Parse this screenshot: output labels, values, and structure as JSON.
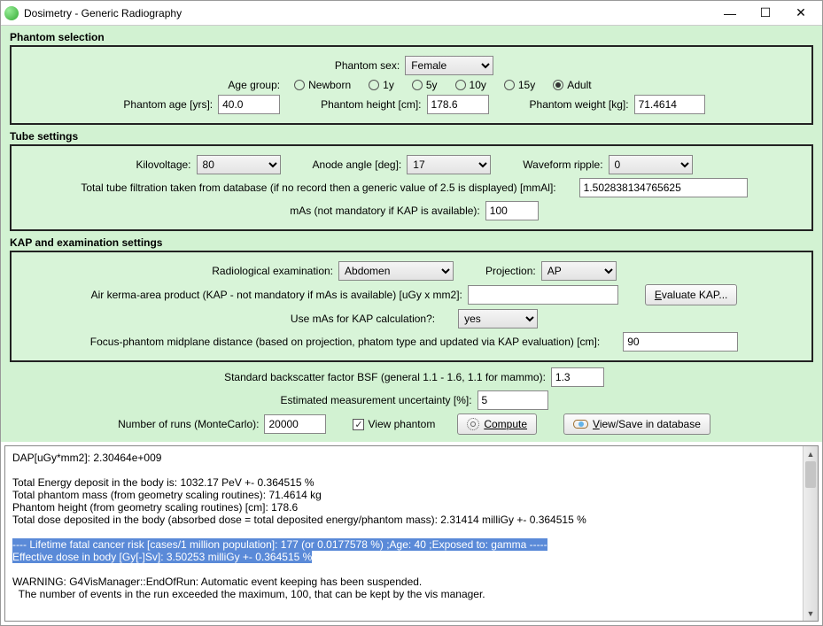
{
  "title": "Dosimetry - Generic Radiography",
  "phantom": {
    "section": "Phantom selection",
    "sex_label": "Phantom sex:",
    "sex_value": "Female",
    "age_group_label": "Age group:",
    "age_groups": [
      "Newborn",
      "1y",
      "5y",
      "10y",
      "15y",
      "Adult"
    ],
    "age_selected_index": 5,
    "age_label": "Phantom age [yrs]:",
    "age_value": "40.0",
    "height_label": "Phantom height [cm]:",
    "height_value": "178.6",
    "weight_label": "Phantom weight [kg]:",
    "weight_value": "71.4614"
  },
  "tube": {
    "section": "Tube settings",
    "kv_label": "Kilovoltage:",
    "kv_value": "80",
    "anode_label": "Anode angle [deg]:",
    "anode_value": "17",
    "ripple_label": "Waveform ripple:",
    "ripple_value": "0",
    "filt_label": "Total tube filtration taken from database (if no record then a generic value of 2.5 is displayed) [mmAl]:",
    "filt_value": "1.502838134765625",
    "mas_label": "mAs (not mandatory if KAP is available):",
    "mas_value": "100"
  },
  "kap": {
    "section": "KAP and examination settings",
    "exam_label": "Radiological examination:",
    "exam_value": "Abdomen",
    "proj_label": "Projection:",
    "proj_value": "AP",
    "kap_label": "Air kerma-area product (KAP - not mandatory if mAs is available) [uGy x mm2]:",
    "kap_value": "",
    "eval_btn": "Evaluate KAP...",
    "use_mas_label": "Use mAs for KAP calculation?:",
    "use_mas_value": "yes",
    "focus_label": "Focus-phantom midplane distance (based on projection, phatom type and updated via KAP evaluation) [cm]:",
    "focus_value": "90"
  },
  "extra": {
    "bsf_label": "Standard backscatter factor BSF (general 1.1 - 1.6, 1.1 for mammo):",
    "bsf_value": "1.3",
    "unc_label": "Estimated measurement uncertainty [%]:",
    "unc_value": "5",
    "runs_label": "Number of runs (MonteCarlo):",
    "runs_value": "20000",
    "view_phantom_label": "View phantom",
    "compute_label": "Compute",
    "viewsave_label": "View/Save in database"
  },
  "output": {
    "line1": "DAP[uGy*mm2]: 2.30464e+009",
    "line2": "Total Energy deposit in the body is: 1032.17 PeV +- 0.364515 %",
    "line3": "Total phantom mass (from geometry scaling routines): 71.4614 kg",
    "line4": "Phantom height (from geometry scaling routines) [cm]: 178.6",
    "line5": "Total dose deposited in the body (absorbed dose = total deposited energy/phantom mass): 2.31414 milliGy +- 0.364515 %",
    "hl1": "---- Lifetime fatal cancer risk [cases/1 million population]: 177 (or 0.0177578 %) ;Age: 40 ;Exposed to: gamma -----",
    "hl2": "Effective dose in body [Gy[-]Sv]: 3.50253 milliGy +- 0.364515 %",
    "line6": "WARNING: G4VisManager::EndOfRun: Automatic event keeping has been suspended.",
    "line7": "  The number of events in the run exceeded the maximum, 100, that can be kept by the vis manager."
  }
}
